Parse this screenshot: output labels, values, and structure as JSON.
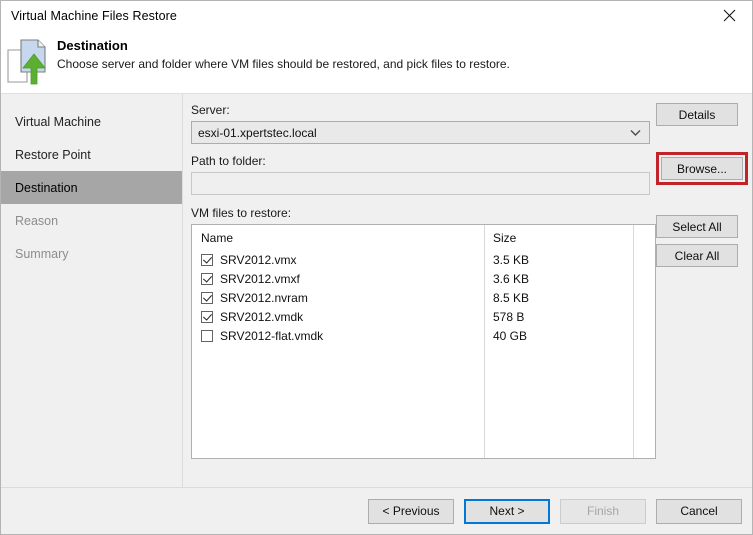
{
  "window": {
    "title": "Virtual Machine Files Restore",
    "close_icon": "close-icon"
  },
  "header": {
    "icon": "files-restore-icon",
    "title": "Destination",
    "subtitle": "Choose server and folder where VM files should be restored, and pick files to restore."
  },
  "sidebar": {
    "items": [
      {
        "label": "Virtual Machine",
        "state": "normal"
      },
      {
        "label": "Restore Point",
        "state": "normal"
      },
      {
        "label": "Destination",
        "state": "active"
      },
      {
        "label": "Reason",
        "state": "dim"
      },
      {
        "label": "Summary",
        "state": "dim"
      }
    ]
  },
  "main": {
    "server_label": "Server:",
    "server_value": "esxi-01.xpertstec.local",
    "server_arrow_icon": "chevron-down-icon",
    "details_button": "Details",
    "path_label": "Path to folder:",
    "path_value": "",
    "path_placeholder": "",
    "browse_button": "Browse...",
    "browse_highlight_color": "#c0232a",
    "files_label": "VM files to restore:",
    "columns": [
      "Name",
      "Size"
    ],
    "files": [
      {
        "name": "SRV2012.vmx",
        "size": "3.5 KB",
        "checked": true
      },
      {
        "name": "SRV2012.vmxf",
        "size": "3.6 KB",
        "checked": true
      },
      {
        "name": "SRV2012.nvram",
        "size": "8.5 KB",
        "checked": true
      },
      {
        "name": "SRV2012.vmdk",
        "size": "578 B",
        "checked": true
      },
      {
        "name": "SRV2012-flat.vmdk",
        "size": "40 GB",
        "checked": false
      }
    ],
    "select_all_button": "Select All",
    "clear_all_button": "Clear All"
  },
  "footer": {
    "previous_button": "< Previous",
    "next_button": "Next >",
    "finish_button": "Finish",
    "cancel_button": "Cancel",
    "focus_accent_color": "#0078d7"
  }
}
